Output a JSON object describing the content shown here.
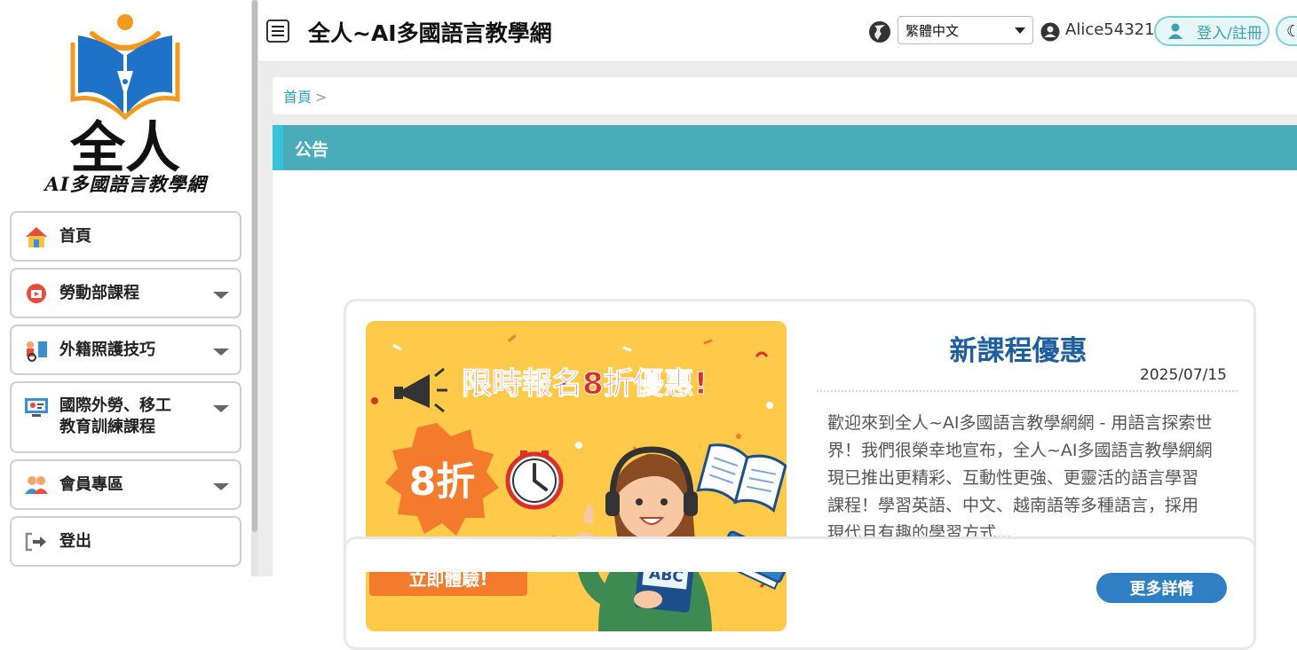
{
  "sidebar": {
    "logo_main": "全人",
    "logo_sub": "AI多國語言教學網",
    "items": [
      {
        "label": "首頁",
        "icon": "home-icon"
      },
      {
        "label": "勞動部課程",
        "icon": "course-icon"
      },
      {
        "label": "外籍照護技巧",
        "icon": "caregiving-icon"
      },
      {
        "label": "國際外勞、移工",
        "label2": "教育訓練課程",
        "icon": "training-icon"
      },
      {
        "label": "會員專區",
        "icon": "members-icon"
      },
      {
        "label": "登出",
        "icon": "logout-icon"
      }
    ]
  },
  "header": {
    "title": "全人~AI多國語言教學網",
    "language": "繁體中文",
    "username": "Alice54321",
    "login_label": "登入/註冊",
    "theme_icon": "moon-icon"
  },
  "breadcrumb": {
    "home": "首頁",
    "separator": ">"
  },
  "announcement": {
    "section_title": "公告",
    "banner": {
      "headline": "限時報名8折優惠!",
      "badge": "8折",
      "cta": "立即體驗!",
      "book_label": "ABC"
    },
    "title": "新課程優惠",
    "date": "2025/07/15",
    "body": "歡迎來到全人~AI多國語言教學網網 - 用語言探索世界！我們很榮幸地宣布，全人~AI多國語言教學網網現已推出更精彩、互動性更強、更靈活的語言學習課程！學習英語、中文、越南語等多種語言，採用現代且有趣的學習方式...",
    "more_label": "更多詳情"
  },
  "colors": {
    "accent": "#4aacb8",
    "title_blue": "#1f5fa0",
    "button_blue": "#2f7fc4",
    "banner_yellow": "#ffc94a",
    "banner_orange": "#f47a2c",
    "banner_red": "#d8302a"
  }
}
